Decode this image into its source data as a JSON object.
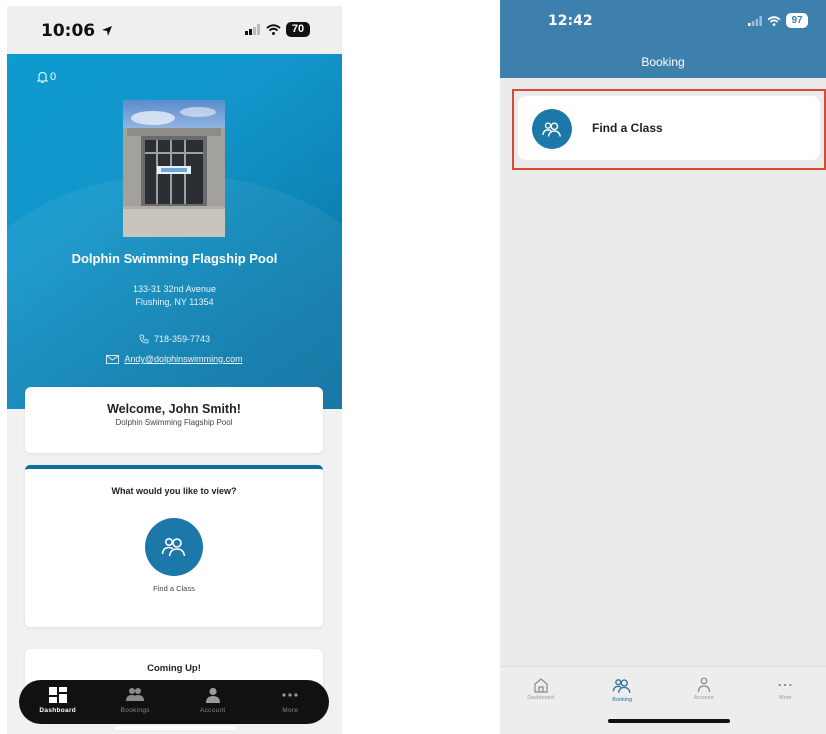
{
  "left": {
    "status_time": "10:06",
    "battery": "70",
    "notification_count": "0",
    "pool_name": "Dolphin Swimming Flagship Pool",
    "address_line1": "133-31 32nd Avenue",
    "address_line2": "Flushing, NY 11354",
    "phone": "718-359-7743",
    "email": "Andy@dolphinswimming.com",
    "welcome_title": "Welcome, John Smith!",
    "welcome_subtitle": "Dolphin Swimming Flagship Pool",
    "view_title": "What would you like to view?",
    "find_class_label": "Find a Class",
    "coming_up_title": "Coming Up!",
    "nav": [
      {
        "label": "Dashboard",
        "icon": "dashboard-icon"
      },
      {
        "label": "Bookings",
        "icon": "bookings-icon"
      },
      {
        "label": "Account",
        "icon": "account-icon"
      },
      {
        "label": "More",
        "icon": "more-icon"
      }
    ]
  },
  "right": {
    "status_time": "12:42",
    "battery": "97",
    "title": "Booking",
    "find_class_label": "Find a Class",
    "nav": [
      {
        "label": "Dashboard",
        "icon": "home-icon"
      },
      {
        "label": "Booking",
        "icon": "booking-icon"
      },
      {
        "label": "Account",
        "icon": "account-icon"
      },
      {
        "label": "More",
        "icon": "more-icon"
      }
    ]
  },
  "colors": {
    "hero_blue": "#0e9bd0",
    "accent_dark": "#1b78a9",
    "header_blue": "#3d7fad",
    "highlight_red": "#d94a34"
  }
}
